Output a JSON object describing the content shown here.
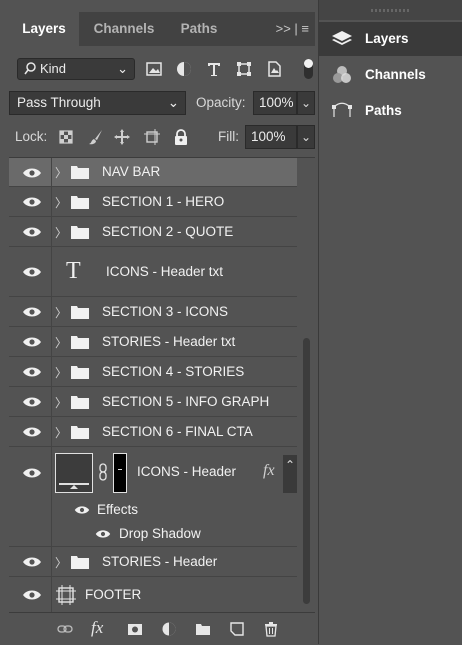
{
  "panel": {
    "tabs": [
      {
        "label": "Layers",
        "active": true
      },
      {
        "label": "Channels",
        "active": false
      },
      {
        "label": "Paths",
        "active": false
      }
    ],
    "menu_glyph": ">> | ≡"
  },
  "filter": {
    "kind_label": "Kind",
    "icons": [
      "pixel-filter-icon",
      "adjustment-filter-icon",
      "type-filter-icon",
      "shape-filter-icon",
      "smart-object-filter-icon"
    ]
  },
  "blend": {
    "mode": "Pass Through",
    "opacity_label": "Opacity:",
    "opacity_value": "100%"
  },
  "lock": {
    "label": "Lock:",
    "fill_label": "Fill:",
    "fill_value": "100%"
  },
  "layers": [
    {
      "name": "NAV BAR",
      "type": "group",
      "selected": true
    },
    {
      "name": "SECTION 1 - HERO",
      "type": "group"
    },
    {
      "name": "SECTION 2 - QUOTE",
      "type": "group"
    },
    {
      "name": "ICONS - Header txt",
      "type": "text"
    },
    {
      "name": "SECTION 3 - ICONS",
      "type": "group"
    },
    {
      "name": "STORIES - Header txt",
      "type": "group"
    },
    {
      "name": "SECTION 4 - STORIES",
      "type": "group"
    },
    {
      "name": "SECTION 5 - INFO GRAPH",
      "type": "group"
    },
    {
      "name": "SECTION 6 - FINAL CTA",
      "type": "group"
    },
    {
      "name": "ICONS - Header",
      "type": "shape",
      "fx": "fx"
    },
    {
      "name": "Effects",
      "type": "effects"
    },
    {
      "name": "Drop Shadow",
      "type": "effect"
    },
    {
      "name": "STORIES - Header",
      "type": "group"
    },
    {
      "name": "FOOTER",
      "type": "smart"
    }
  ],
  "bottom_toolbar": [
    "link-icon",
    "fx-icon",
    "mask-icon",
    "adjustment-icon",
    "new-group-icon",
    "new-layer-icon",
    "trash-icon"
  ],
  "dock": {
    "items": [
      {
        "label": "Layers",
        "icon": "layers-icon",
        "active": true
      },
      {
        "label": "Channels",
        "icon": "channels-icon",
        "active": false
      },
      {
        "label": "Paths",
        "icon": "paths-icon",
        "active": false
      }
    ]
  },
  "colors": {
    "panel_bg": "#535353",
    "selected_row": "#6a6a6a",
    "input_bg": "#3a3a3a",
    "text": "#f2f2f2"
  }
}
